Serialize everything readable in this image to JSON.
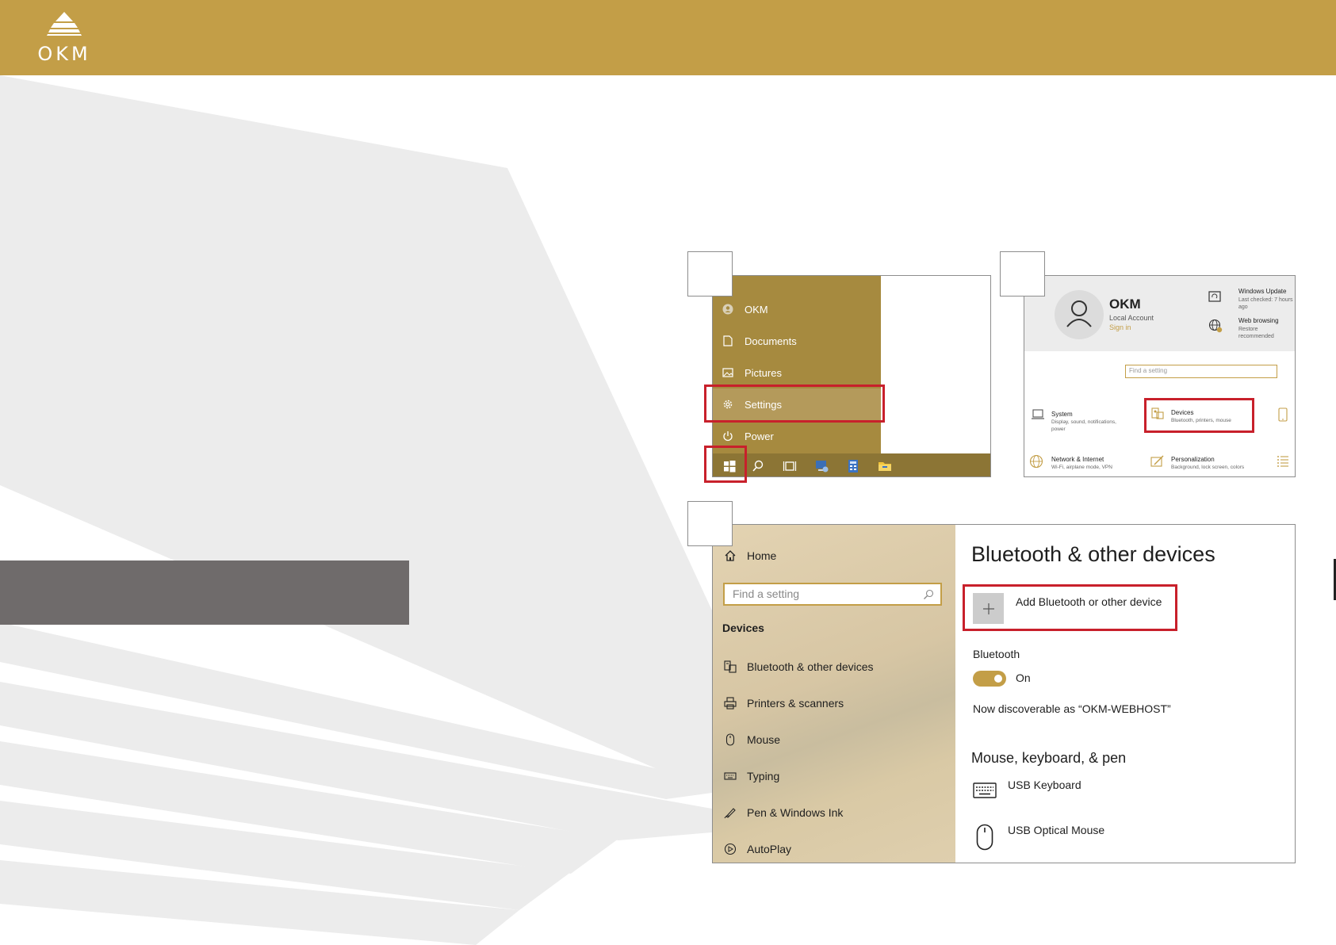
{
  "brand": {
    "logo_text": "OKM",
    "color": "#c39e47"
  },
  "steps": {
    "one": "",
    "two": "",
    "three": ""
  },
  "start_menu": {
    "items": [
      "OKM",
      "Documents",
      "Pictures",
      "Settings",
      "Power"
    ],
    "highlighted": "Settings"
  },
  "settings_home": {
    "account_name": "OKM",
    "account_type": "Local Account",
    "sign_in": "Sign in",
    "windows_update_title": "Windows Update",
    "windows_update_sub": "Last checked: 7 hours ago",
    "web_browsing_title": "Web browsing",
    "web_browsing_sub": "Restore recommended",
    "search_placeholder": "Find a setting",
    "categories": [
      {
        "title": "System",
        "sub": "Display, sound, notifications, power"
      },
      {
        "title": "Devices",
        "sub": "Bluetooth, printers, mouse"
      },
      {
        "title": "Network & Internet",
        "sub": "Wi-Fi, airplane mode, VPN"
      },
      {
        "title": "Personalization",
        "sub": "Background, lock screen, colors"
      }
    ]
  },
  "devices_settings": {
    "home": "Home",
    "search_placeholder": "Find a setting",
    "section": "Devices",
    "nav": [
      "Bluetooth & other devices",
      "Printers & scanners",
      "Mouse",
      "Typing",
      "Pen & Windows Ink",
      "AutoPlay"
    ],
    "title": "Bluetooth & other devices",
    "add_button": "Add Bluetooth or other device",
    "bluetooth_label": "Bluetooth",
    "bluetooth_state": "On",
    "discoverable": "Now discoverable as “OKM-WEBHOST”",
    "peripherals_heading": "Mouse, keyboard, & pen",
    "devices": [
      "USB Keyboard",
      "USB Optical Mouse"
    ]
  }
}
